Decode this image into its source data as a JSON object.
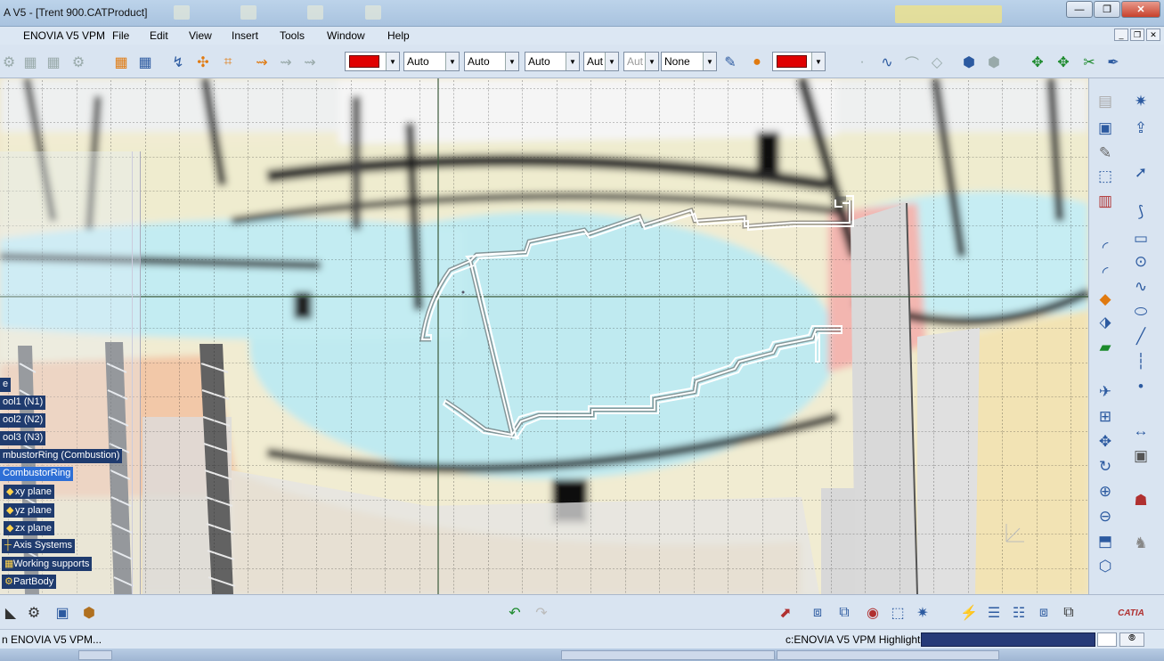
{
  "window": {
    "title": "A V5 - [Trent 900.CATProduct]",
    "controls": {
      "minimize": "—",
      "restore": "❐",
      "close": "✕"
    }
  },
  "menubar": {
    "items": [
      "ENOVIA V5 VPM",
      "File",
      "Edit",
      "View",
      "Insert",
      "Tools",
      "Window",
      "Help"
    ],
    "mdi_controls": {
      "minimize": "_",
      "restore": "❐",
      "close": "✕"
    }
  },
  "toolbar": {
    "color_dropdown_1": "",
    "transparency": "Auto",
    "thickness": "Auto",
    "linetype": "Auto",
    "point_style": "Aut",
    "layer_disabled": "Aut",
    "render_style": "None",
    "color_dropdown_2": ""
  },
  "colors": {
    "swatch_red": "#e00000",
    "tree_item_bg": "#1f3b6e",
    "tree_selected_bg": "#2e6fd6",
    "status_input": "#263a78",
    "sketch_profile": "#ffffff",
    "background_blue": "#bfeaf0"
  },
  "spec_tree": {
    "items": [
      {
        "label": "e",
        "selected": false
      },
      {
        "label": "ool1 (N1)",
        "selected": false
      },
      {
        "label": "ool2 (N2)",
        "selected": false
      },
      {
        "label": "ool3 (N3)",
        "selected": false
      },
      {
        "label": "mbustorRing (Combustion)",
        "selected": false
      },
      {
        "label": "CombustorRing",
        "selected": true
      },
      {
        "label": "xy plane",
        "selected": false
      },
      {
        "label": "yz plane",
        "selected": false
      },
      {
        "label": "zx plane",
        "selected": false
      },
      {
        "label": "Axis Systems",
        "selected": false
      },
      {
        "label": "Working supports",
        "selected": false
      },
      {
        "label": "PartBody",
        "selected": false
      }
    ]
  },
  "statusbar": {
    "left_text": "n ENOVIA V5 VPM...",
    "right_text": "c:ENOVIA V5 VPM Highlight",
    "command_input": ""
  },
  "brand": {
    "logo_text": "CATIA"
  }
}
